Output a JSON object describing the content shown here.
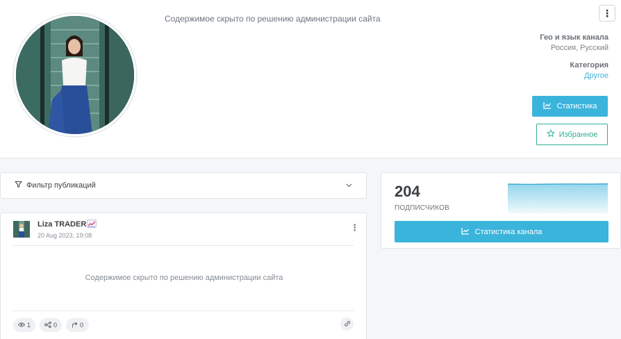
{
  "header": {
    "hidden_notice": "Содержимое скрыто по решению администрации сайта",
    "geo_title": "Гео и язык канала",
    "geo_value": "Россия, Русский",
    "category_title": "Категория",
    "category_value": "Другое",
    "stats_button": "Статистика",
    "favorite_button": "Избранное"
  },
  "filter": {
    "label": "Фильтр публикаций"
  },
  "post": {
    "author": "Liza TRADER",
    "date": "20 Aug 2023, 19:08",
    "hidden_notice": "Содержимое скрыто по решению администрации сайта",
    "views": "1",
    "shares": "0",
    "forwards": "0"
  },
  "subscribers": {
    "count": "204",
    "label": "ПОДПИСЧИКОВ",
    "button": "Статистика канала"
  },
  "colors": {
    "accent": "#3bb4dc",
    "favorite": "#2fae95",
    "link": "#3fb3d8"
  },
  "icons": [
    "kebab-icon",
    "chart-line-icon",
    "star-icon",
    "filter-icon",
    "chevron-down-icon",
    "eye-icon",
    "share-icon",
    "forward-icon",
    "link-icon",
    "chart-emoji-icon"
  ]
}
